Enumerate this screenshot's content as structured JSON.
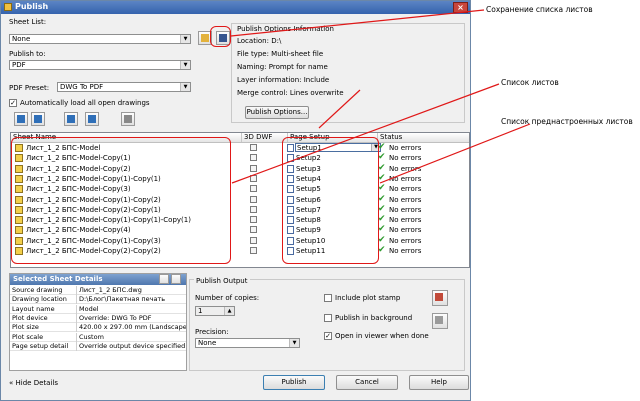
{
  "window": {
    "title": "Publish",
    "close_glyph": "×"
  },
  "sheet_list": {
    "label": "Sheet List:",
    "value": "None"
  },
  "publish_to": {
    "label": "Publish to:",
    "value": "PDF"
  },
  "pdf_preset": {
    "label": "PDF Preset:",
    "value": "DWG To PDF"
  },
  "auto_load": {
    "label": "Automatically load all open drawings",
    "checked": true
  },
  "options_info": {
    "title": "Publish Options Information",
    "location": "Location: D:\\",
    "file_type": "File type: Multi-sheet file",
    "naming": "Naming: Prompt for name",
    "layer_info": "Layer information: Include",
    "merge_control": "Merge control: Lines overwrite",
    "button": "Publish Options..."
  },
  "table": {
    "columns": [
      "Sheet Name",
      "3D DWF",
      "Page Setup",
      "Status"
    ],
    "rows": [
      {
        "sheet": "Лист_1_2 БПС-Model",
        "setup": "Setup1",
        "status": "No errors"
      },
      {
        "sheet": "Лист_1_2 БПС-Model-Copy(1)",
        "setup": "Setup2",
        "status": "No errors"
      },
      {
        "sheet": "Лист_1_2 БПС-Model-Copy(2)",
        "setup": "Setup3",
        "status": "No errors"
      },
      {
        "sheet": "Лист_1_2 БПС-Model-Copy(1)-Copy(1)",
        "setup": "Setup4",
        "status": "No errors"
      },
      {
        "sheet": "Лист_1_2 БПС-Model-Copy(3)",
        "setup": "Setup5",
        "status": "No errors"
      },
      {
        "sheet": "Лист_1_2 БПС-Model-Copy(1)-Copy(2)",
        "setup": "Setup6",
        "status": "No errors"
      },
      {
        "sheet": "Лист_1_2 БПС-Model-Copy(2)-Copy(1)",
        "setup": "Setup7",
        "status": "No errors"
      },
      {
        "sheet": "Лист_1_2 БПС-Model-Copy(1)-Copy(1)-Copy(1)",
        "setup": "Setup8",
        "status": "No errors"
      },
      {
        "sheet": "Лист_1_2 БПС-Model-Copy(4)",
        "setup": "Setup9",
        "status": "No errors"
      },
      {
        "sheet": "Лист_1_2 БПС-Model-Copy(1)-Copy(3)",
        "setup": "Setup10",
        "status": "No errors"
      },
      {
        "sheet": "Лист_1_2 БПС-Model-Copy(2)-Copy(2)",
        "setup": "Setup11",
        "status": "No errors"
      }
    ]
  },
  "details": {
    "title": "Selected Sheet Details",
    "rows": [
      {
        "key": "Source drawing",
        "value": "Лист_1_2 БПС.dwg"
      },
      {
        "key": "Drawing location",
        "value": "D:\\Блог\\Пакетная печать"
      },
      {
        "key": "Layout name",
        "value": "Model"
      },
      {
        "key": "Plot device",
        "value": "Override: DWG To PDF"
      },
      {
        "key": "Plot size",
        "value": "420.00 x 297.00 mm (Landscape)"
      },
      {
        "key": "Plot scale",
        "value": "Custom"
      },
      {
        "key": "Page setup detail",
        "value": "Override output device specified i..."
      }
    ]
  },
  "publish_output": {
    "title": "Publish Output",
    "copies_label": "Number of copies:",
    "copies_value": "1",
    "precision_label": "Precision:",
    "precision_value": "None",
    "include_plot_stamp": "Include plot stamp",
    "publish_background": "Publish in background",
    "open_viewer": "Open in viewer when done"
  },
  "footer": {
    "hide_details": "Hide Details",
    "publish": "Publish",
    "cancel": "Cancel",
    "help": "Help"
  },
  "annotations": {
    "save_list": "Сохранение списка листов",
    "sheet_list": "Список листов",
    "preset_list": "Список преднастроенных листов"
  },
  "colors": {
    "highlight": "#e01818",
    "title_bar": "#3463ad",
    "status_ok": "#2e9a2e"
  }
}
